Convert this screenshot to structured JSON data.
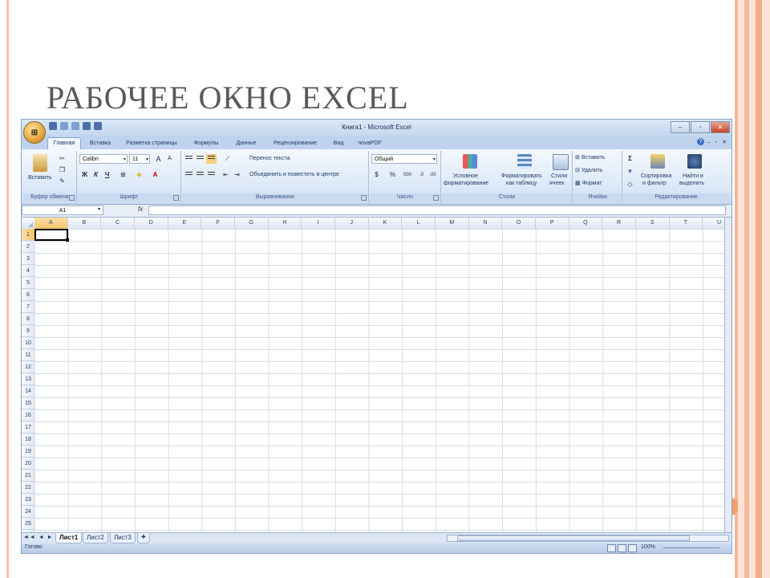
{
  "slide": {
    "title": "РАБОЧЕЕ ОКНО EXCEL"
  },
  "window": {
    "title": "Книга1 - Microsoft Excel",
    "controls": {
      "minimize": "–",
      "restore": "▫",
      "close": "✕"
    }
  },
  "office_button": {
    "label": "⊞"
  },
  "ribbon": {
    "tabs": [
      "Главная",
      "Вставка",
      "Разметка страницы",
      "Формулы",
      "Данные",
      "Рецензирование",
      "Вид",
      "novaPDF"
    ],
    "active_tab": "Главная",
    "help": "?",
    "clipboard": {
      "label": "Буфер обмена",
      "paste": "Вставить"
    },
    "font": {
      "label": "Шрифт",
      "name": "Calibri",
      "size": "11",
      "bold": "Ж",
      "italic": "К",
      "underline": "Ч",
      "grow": "A",
      "shrink": "A"
    },
    "alignment": {
      "label": "Выравнивание",
      "wrap": "Перенос текста",
      "merge": "Объединить и поместить в центре"
    },
    "number": {
      "label": "Число",
      "format": "Общий",
      "percent": "%",
      "thousands": "000"
    },
    "styles": {
      "label": "Стили",
      "conditional_1": "Условное",
      "conditional_2": "форматирование",
      "table_1": "Форматировать",
      "table_2": "как таблицу",
      "cell_1": "Стили",
      "cell_2": "ячеек"
    },
    "cells": {
      "label": "Ячейки",
      "insert": "Вставить",
      "delete": "Удалить",
      "format": "Формат"
    },
    "editing": {
      "label": "Редактирование",
      "sum": "Σ",
      "sort_1": "Сортировка",
      "sort_2": "и фильтр",
      "find_1": "Найти и",
      "find_2": "выделить"
    }
  },
  "formula_bar": {
    "name_box": "A1",
    "fx": "fx",
    "value": ""
  },
  "grid": {
    "columns": [
      "A",
      "B",
      "C",
      "D",
      "E",
      "F",
      "G",
      "H",
      "I",
      "J",
      "K",
      "L",
      "M",
      "N",
      "O",
      "P",
      "Q",
      "R",
      "S",
      "T",
      "U"
    ],
    "rows": [
      "1",
      "2",
      "3",
      "4",
      "5",
      "6",
      "7",
      "8",
      "9",
      "10",
      "11",
      "12",
      "13",
      "14",
      "15",
      "16",
      "17",
      "18",
      "19",
      "20",
      "21",
      "22",
      "23",
      "24",
      "25"
    ],
    "active_cell": "A1"
  },
  "sheets": {
    "nav": "◄◄ ◄ ► ►►",
    "tabs": [
      "Лист1",
      "Лист2",
      "Лист3"
    ],
    "active": "Лист1"
  },
  "status_bar": {
    "status": "Готово",
    "zoom": "100%"
  }
}
